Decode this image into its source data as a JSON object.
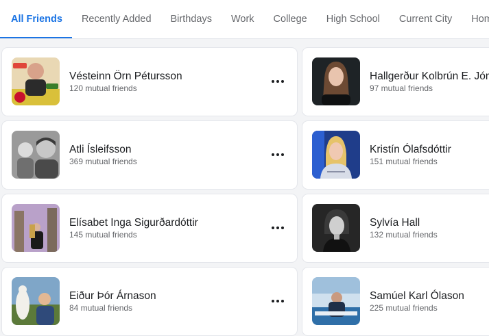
{
  "tabs": [
    {
      "label": "All Friends",
      "active": true
    },
    {
      "label": "Recently Added"
    },
    {
      "label": "Birthdays"
    },
    {
      "label": "Work"
    },
    {
      "label": "College"
    },
    {
      "label": "High School"
    },
    {
      "label": "Current City"
    },
    {
      "label": "Hometown"
    }
  ],
  "friends": [
    {
      "name": "Vésteinn Örn Pétursson",
      "mutual": "120 mutual friends",
      "more_icon": "ellipsis-icon"
    },
    {
      "name": "Hallgerður Kolbrún E. Jóns",
      "mutual": "97 mutual friends"
    },
    {
      "name": "Atli Ísleifsson",
      "mutual": "369 mutual friends",
      "more_icon": "ellipsis-icon"
    },
    {
      "name": "Kristín Ólafsdóttir",
      "mutual": "151 mutual friends"
    },
    {
      "name": "Elísabet Inga Sigurðardóttir",
      "mutual": "145 mutual friends",
      "more_icon": "ellipsis-icon"
    },
    {
      "name": "Sylvía Hall",
      "mutual": "132 mutual friends"
    },
    {
      "name": "Eiður Þór Árnason",
      "mutual": "84 mutual friends",
      "more_icon": "ellipsis-icon"
    },
    {
      "name": "Samúel Karl Ólason",
      "mutual": "225 mutual friends"
    }
  ],
  "colors": {
    "accent": "#1b74e4",
    "text": "#1c1e21",
    "secondary": "#65676b"
  }
}
